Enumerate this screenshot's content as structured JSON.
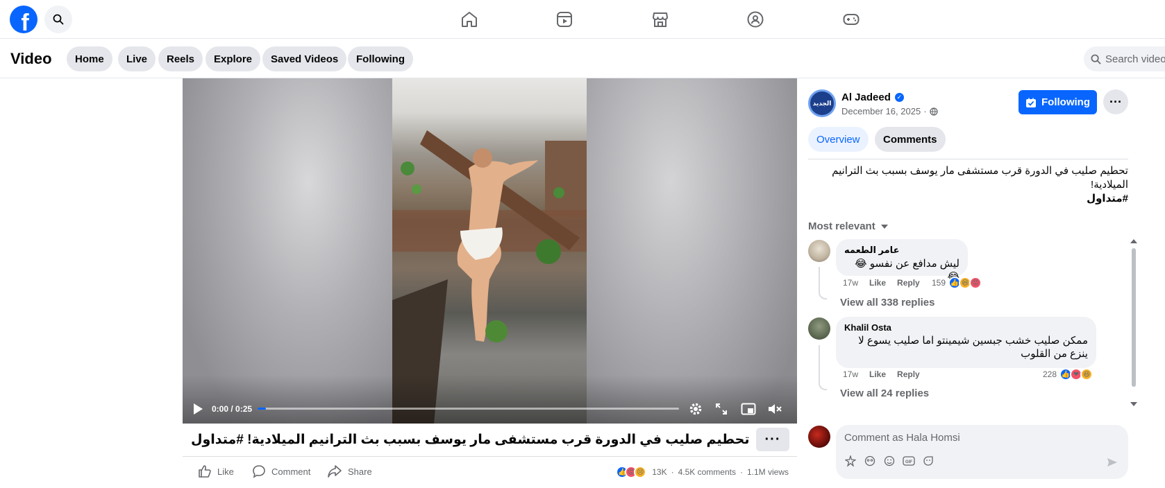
{
  "top_nav": {
    "logo_letter": "f",
    "icons": [
      "home-icon",
      "video-icon",
      "marketplace-icon",
      "groups-icon",
      "gaming-icon"
    ]
  },
  "sub_header": {
    "title": "Video",
    "tabs": [
      "Home",
      "Live",
      "Reels",
      "Explore",
      "Saved Videos",
      "Following"
    ],
    "search_placeholder": "Search videos"
  },
  "player": {
    "time": "0:00 / 0:25",
    "progress": 0.02
  },
  "video_info": {
    "title": "تحطيم صليب في الدورة قرب مستشفى مار يوسف بسبب بث الترانيم الميلادية! #متداول",
    "more": "···",
    "actions": {
      "like": "Like",
      "comment": "Comment",
      "share": "Share"
    },
    "reaction_count": "13K",
    "comments_count": "4.5K comments",
    "views": "1.1M views"
  },
  "page": {
    "avatar_text": "الجديد",
    "name": "Al Jadeed",
    "date": "December 16, 2025",
    "date_sep": "·",
    "following_label": "Following",
    "more": "···"
  },
  "panel_tabs": {
    "overview": "Overview",
    "comments": "Comments"
  },
  "description": {
    "line": "تحطيم صليب في الدورة قرب مستشفى مار يوسف بسبب بث الترانيم الميلادية!",
    "hashtag": "#متداول"
  },
  "sort_label": "Most relevant",
  "comments": [
    {
      "author": "عامر الطعمه",
      "text": "ليش مدافع عن نفسو 😂😂",
      "time": "17w",
      "like": "Like",
      "reply": "Reply",
      "reactions": "159",
      "view_replies": "View all 338 replies"
    },
    {
      "author": "Khalil Osta",
      "text": "ممكن صليب خشب جبسين شيمينتو اما صليب يسوع لا ينزع من القلوب",
      "time": "17w",
      "like": "Like",
      "reply": "Reply",
      "reactions": "228",
      "view_replies": "View all 24 replies"
    }
  ],
  "composer": {
    "placeholder": "Comment as Hala Homsi"
  },
  "colors": {
    "brand": "#0866ff",
    "panel_bg": "#f0f2f5",
    "pill_bg": "#e4e6eb",
    "muted": "#65676b"
  }
}
